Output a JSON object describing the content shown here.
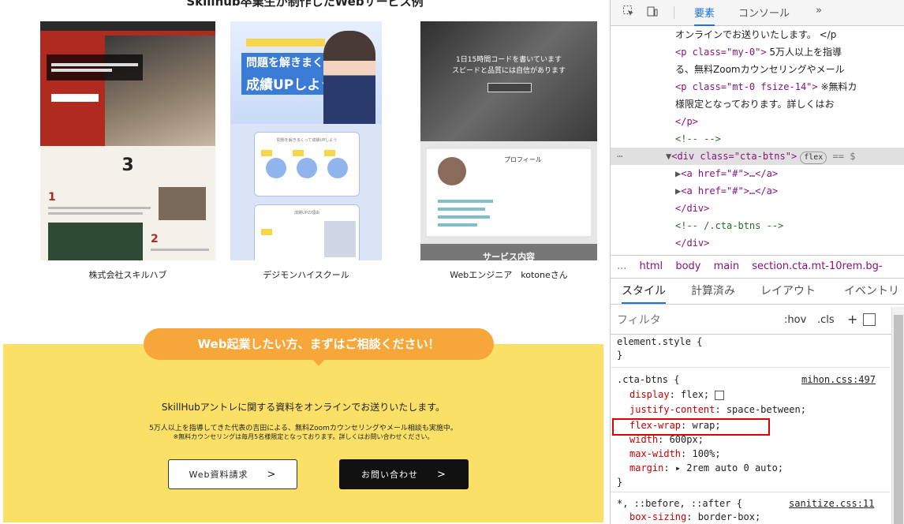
{
  "showcase": {
    "title": "Skillhub卒業生が制作したWebサービス例",
    "items": [
      {
        "name": "株式会社スキルハブ",
        "three": "3"
      },
      {
        "name": "デジモンハイスクール",
        "title1": "問題を解きまくって",
        "title2": "成績UPしよう",
        "card1": "問題を解きまくって成績UPしよう",
        "card2": "成績UPの理由"
      },
      {
        "name": "Webエンジニア　kotoneさん",
        "hero1": "1日15時間コードを書いています",
        "hero2": "スピードと品質には自信があります",
        "profile": "プロフィール",
        "service": "サービス内容"
      }
    ]
  },
  "cta": {
    "ribbon": "Web起業したい方、まずはご相談ください！",
    "main": "SkillHubアントレに関する資料をオンラインでお送りいたします。",
    "sub1": "5万人以上を指導してきた代表の吉田による、無料Zoomカウンセリングやメール相談も実施中。",
    "sub2": "※無料カウンセリングは毎月5名様限定となっております。詳しくはお問い合わせください。",
    "btn_doc": "Web資料請求",
    "btn_contact": "お問い合わせ",
    "arrow": ">"
  },
  "devtools": {
    "tabs": [
      "要素",
      "コンソール",
      "»"
    ],
    "dom": [
      {
        "text": "オンラインでお送りいたします。 </p"
      },
      {
        "tag": "<p class=\"my-0\">",
        "text": " 5万人以上を指導"
      },
      {
        "text": "る、無料Zoomカウンセリングやメール"
      },
      {
        "tag": "<p class=\"mt-0 fsize-14\">",
        "text": " ※無料カ"
      },
      {
        "text": "様限定となっております。詳しくはお"
      },
      {
        "tag": "</p>"
      },
      {
        "comment": "<!-- -->"
      },
      {
        "tag": "<div class=\"cta-btns\">",
        "badge": "flex",
        "extra": "== $"
      },
      {
        "tag": "<a href=\"#\">…</a>"
      },
      {
        "tag": "<a href=\"#\">…</a>"
      },
      {
        "tag": "</div>"
      },
      {
        "comment": "<!-- /.cta-btns -->"
      },
      {
        "tag": "</div>"
      }
    ],
    "breadcrumb": [
      "...",
      "html",
      "body",
      "main",
      "section.cta.mt-10rem.bg-"
    ],
    "style_tabs": [
      "スタイル",
      "計算済み",
      "レイアウト",
      "イベントリ"
    ],
    "filter_placeholder": "フィルタ",
    "filter_buttons": [
      ":hov",
      ".cls",
      "+"
    ],
    "rules": {
      "element_style": "element.style {",
      "close": "}",
      "cta_selector": ".cta-btns {",
      "cta_source": "mihon.css:497",
      "props": [
        {
          "name": "display",
          "value": "flex;"
        },
        {
          "name": "justify-content",
          "value": "space-between;"
        },
        {
          "name": "flex-wrap",
          "value": "wrap;"
        },
        {
          "name": "width",
          "value": "600px;"
        },
        {
          "name": "max-width",
          "value": "100%;"
        },
        {
          "name": "margin",
          "value": "▸ 2rem auto 0 auto;"
        }
      ],
      "universal_selector": "*, ::before, ::after {",
      "universal_source": "sanitize.css:11",
      "universal_prop": {
        "name": "box-sizing",
        "value": "border-box;"
      }
    },
    "highlight_color": "#e00000"
  }
}
